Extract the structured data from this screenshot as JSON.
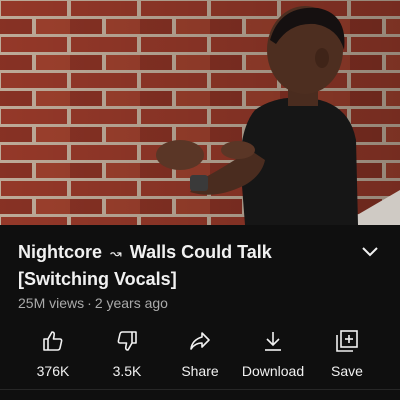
{
  "video": {
    "title_left": "Nightcore",
    "title_glyph": "↝",
    "title_right": "Walls Could Talk [Switching Vocals]",
    "views": "25M views",
    "separator": "·",
    "age": "2 years ago",
    "expand_icon": "chevron-down-icon"
  },
  "actions": [
    {
      "label": "376K",
      "icon": "thumbs-up-icon"
    },
    {
      "label": "3.5K",
      "icon": "thumbs-down-icon"
    },
    {
      "label": "Share",
      "icon": "share-icon"
    },
    {
      "label": "Download",
      "icon": "download-icon"
    },
    {
      "label": "Save",
      "icon": "add-to-playlist-icon"
    }
  ],
  "colors": {
    "background": "#0f0f0f",
    "text_primary": "#f1f1f1",
    "text_secondary": "#aaaaaa",
    "brick": "#9b3a2a",
    "mortar": "#c9b8a6"
  }
}
